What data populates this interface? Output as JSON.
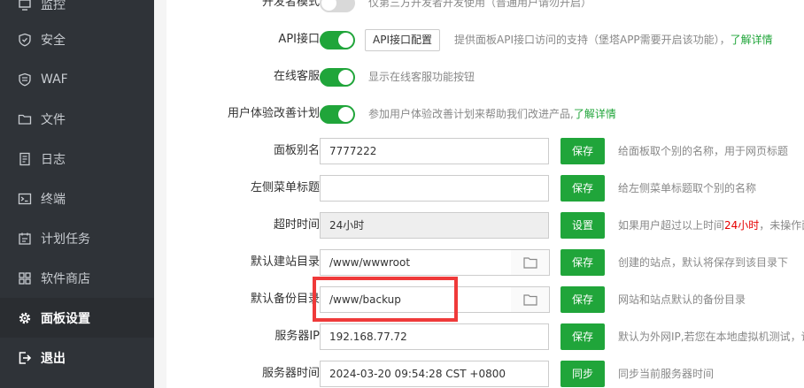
{
  "sidebar": {
    "items": [
      {
        "label": "监控",
        "icon": "monitor-icon"
      },
      {
        "label": "安全",
        "icon": "shield-icon"
      },
      {
        "label": "WAF",
        "icon": "waf-shield-icon"
      },
      {
        "label": "文件",
        "icon": "folder-icon"
      },
      {
        "label": "日志",
        "icon": "log-icon"
      },
      {
        "label": "终端",
        "icon": "terminal-icon"
      },
      {
        "label": "计划任务",
        "icon": "calendar-icon"
      },
      {
        "label": "软件商店",
        "icon": "grid-icon"
      },
      {
        "label": "面板设置",
        "icon": "gear-icon"
      },
      {
        "label": "退出",
        "icon": "logout-icon"
      }
    ],
    "active_index": 8
  },
  "settings": {
    "dev_mode": {
      "label": "开发者模式",
      "desc": "仅第三方开发者开发使用（普通用户请勿开启）",
      "enabled": false
    },
    "api": {
      "label": "API接口",
      "button": "API接口配置",
      "desc": "提供面板API接口访问的支持（堡塔APP需要开启该功能），",
      "link": "了解详情",
      "enabled": true
    },
    "online_service": {
      "label": "在线客服",
      "desc": "显示在线客服功能按钮",
      "enabled": true
    },
    "ux_plan": {
      "label": "用户体验改善计划",
      "desc": "参加用户体验改善计划来帮助我们改进产品,",
      "link": "了解详情",
      "enabled": true
    },
    "panel_alias": {
      "label": "面板别名",
      "value": "7777222",
      "button": "保存",
      "desc": "给面板取个别的名称，用于网页标题"
    },
    "menu_title": {
      "label": "左侧菜单标题",
      "value": "",
      "button": "保存",
      "desc": "给左侧菜单标题取个别的名称"
    },
    "timeout": {
      "label": "超时时间",
      "value": "24小时",
      "button": "设置",
      "desc_before": "如果用户超过以上时间",
      "desc_highlight": "24小时",
      "desc_after": "，未操作面"
    },
    "site_dir": {
      "label": "默认建站目录",
      "value": "/www/wwwroot",
      "button": "保存",
      "desc": "创建的站点，默认将保存到该目录下"
    },
    "backup_dir": {
      "label": "默认备份目录",
      "value": "/www/backup",
      "button": "保存",
      "desc": "网站和站点默认的备份目录"
    },
    "server_ip": {
      "label": "服务器IP",
      "value": "192.168.77.72",
      "button": "保存",
      "desc": "默认为外网IP,若您在本地虚拟机测试，请"
    },
    "server_time": {
      "label": "服务器时间",
      "value": "2024-03-20 09:54:28 CST +0800",
      "button": "同步",
      "desc": "同步当前服务器时间"
    }
  },
  "colors": {
    "accent": "#20a53a",
    "highlight_box": "#ef3a3a",
    "sidebar_bg": "#2f3338"
  }
}
